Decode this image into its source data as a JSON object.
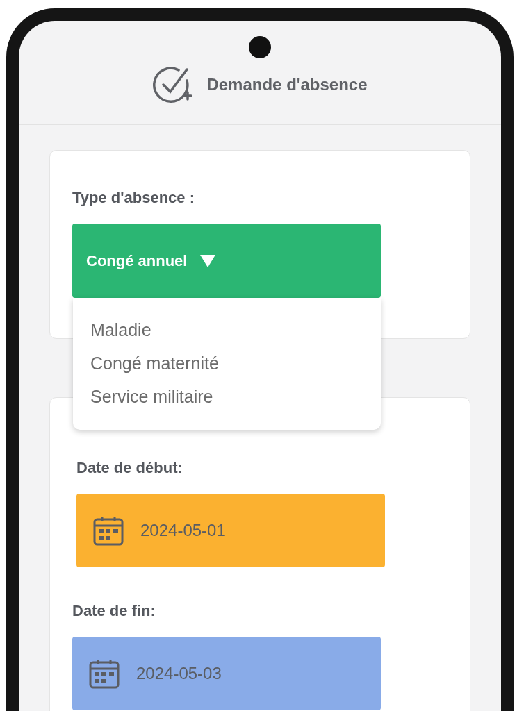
{
  "header": {
    "title": "Demande d'absence"
  },
  "absence_type": {
    "label": "Type d'absence :",
    "value": "Congé annuel",
    "expanded": true,
    "options": [
      {
        "label": "Maladie"
      },
      {
        "label": "Congé maternité"
      },
      {
        "label": "Service militaire"
      }
    ]
  },
  "dates": [
    {
      "label": "Date de début:",
      "value": "2024-05-01",
      "color": "#fbb130"
    },
    {
      "label": "Date de fin:",
      "value": "2024-05-03",
      "color": "#89abe8"
    }
  ]
}
